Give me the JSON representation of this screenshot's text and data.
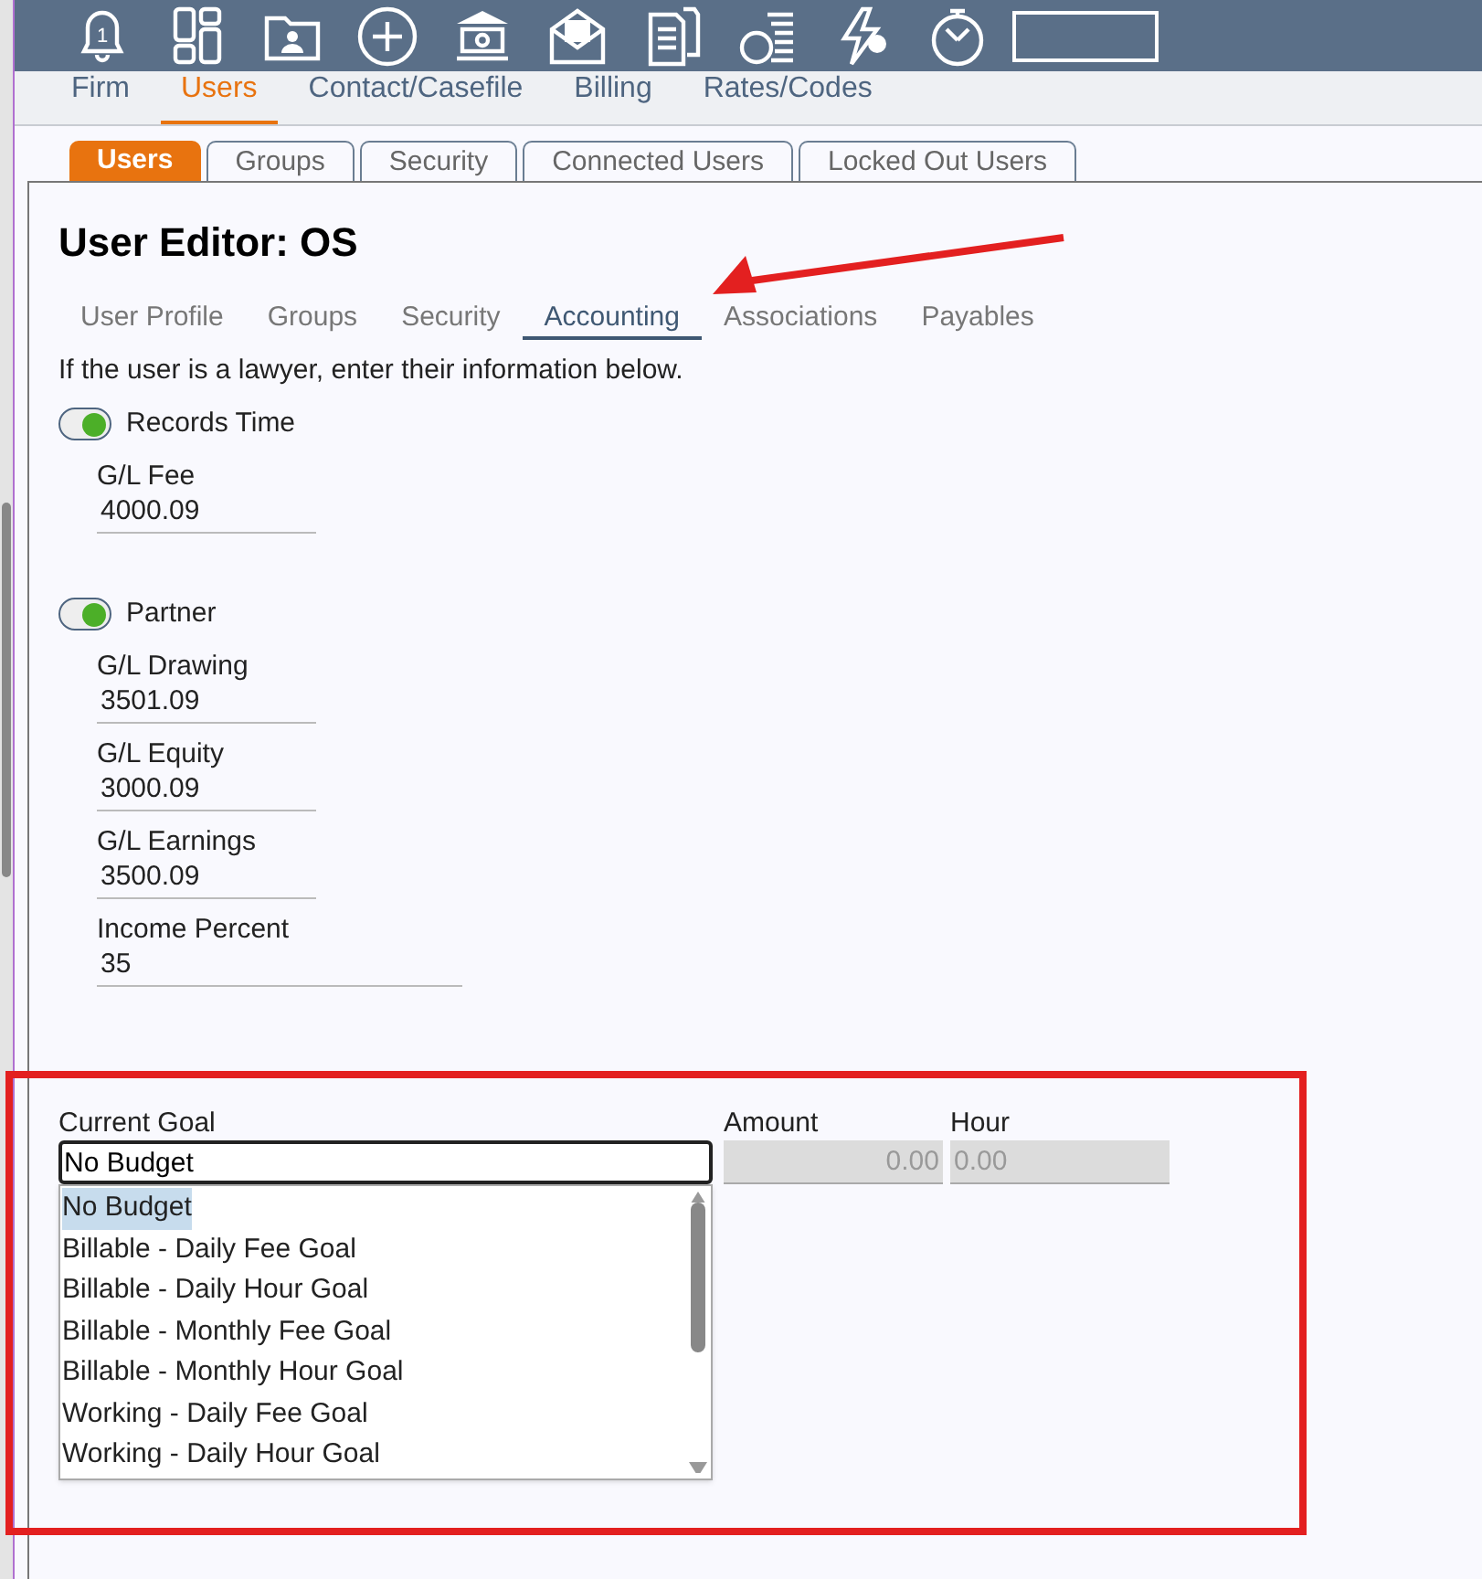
{
  "toolbar": {
    "notification_count": "1"
  },
  "main_nav": [
    {
      "label": "Firm",
      "selected": false
    },
    {
      "label": "Users",
      "selected": true
    },
    {
      "label": "Contact/Casefile",
      "selected": false
    },
    {
      "label": "Billing",
      "selected": false
    },
    {
      "label": "Rates/Codes",
      "selected": false
    }
  ],
  "sub_tabs": [
    {
      "label": "Users",
      "selected": true
    },
    {
      "label": "Groups",
      "selected": false
    },
    {
      "label": "Security",
      "selected": false
    },
    {
      "label": "Connected Users",
      "selected": false
    },
    {
      "label": "Locked Out Users",
      "selected": false
    }
  ],
  "title": "User Editor: OS",
  "section_tabs": [
    {
      "label": "User Profile",
      "selected": false
    },
    {
      "label": "Groups",
      "selected": false
    },
    {
      "label": "Security",
      "selected": false
    },
    {
      "label": "Accounting",
      "selected": true
    },
    {
      "label": "Associations",
      "selected": false
    },
    {
      "label": "Payables",
      "selected": false
    }
  ],
  "intro": "If the user is a lawyer, enter their information below.",
  "items": [
    {
      "kind": "toggle",
      "label": "Records Time",
      "on": true
    },
    {
      "kind": "field",
      "label": "G/L Fee",
      "value": "4000.09"
    },
    {
      "kind": "toggle",
      "label": "Partner",
      "on": true
    },
    {
      "kind": "field",
      "label": "G/L Drawing",
      "value": "3501.09"
    },
    {
      "kind": "field",
      "label": "G/L Equity",
      "value": "3000.09"
    },
    {
      "kind": "field",
      "label": "G/L Earnings",
      "value": "3500.09"
    },
    {
      "kind": "wide_field",
      "label": "Income Percent",
      "value": "35"
    }
  ],
  "goal": {
    "label": "Current Goal",
    "value": "No Budget",
    "options": [
      {
        "label": "No Budget",
        "selected": true
      },
      {
        "label": "Billable - Daily Fee Goal",
        "selected": false
      },
      {
        "label": "Billable - Daily Hour Goal",
        "selected": false
      },
      {
        "label": "Billable - Monthly Fee Goal",
        "selected": false
      },
      {
        "label": "Billable - Monthly Hour Goal",
        "selected": false
      },
      {
        "label": "Working - Daily Fee Goal",
        "selected": false
      },
      {
        "label": "Working - Daily Hour Goal",
        "selected": false
      }
    ],
    "amount": {
      "label": "Amount",
      "value": "0.00",
      "disabled": true
    },
    "hour": {
      "label": "Hour",
      "value": "0.00",
      "disabled": true
    }
  }
}
